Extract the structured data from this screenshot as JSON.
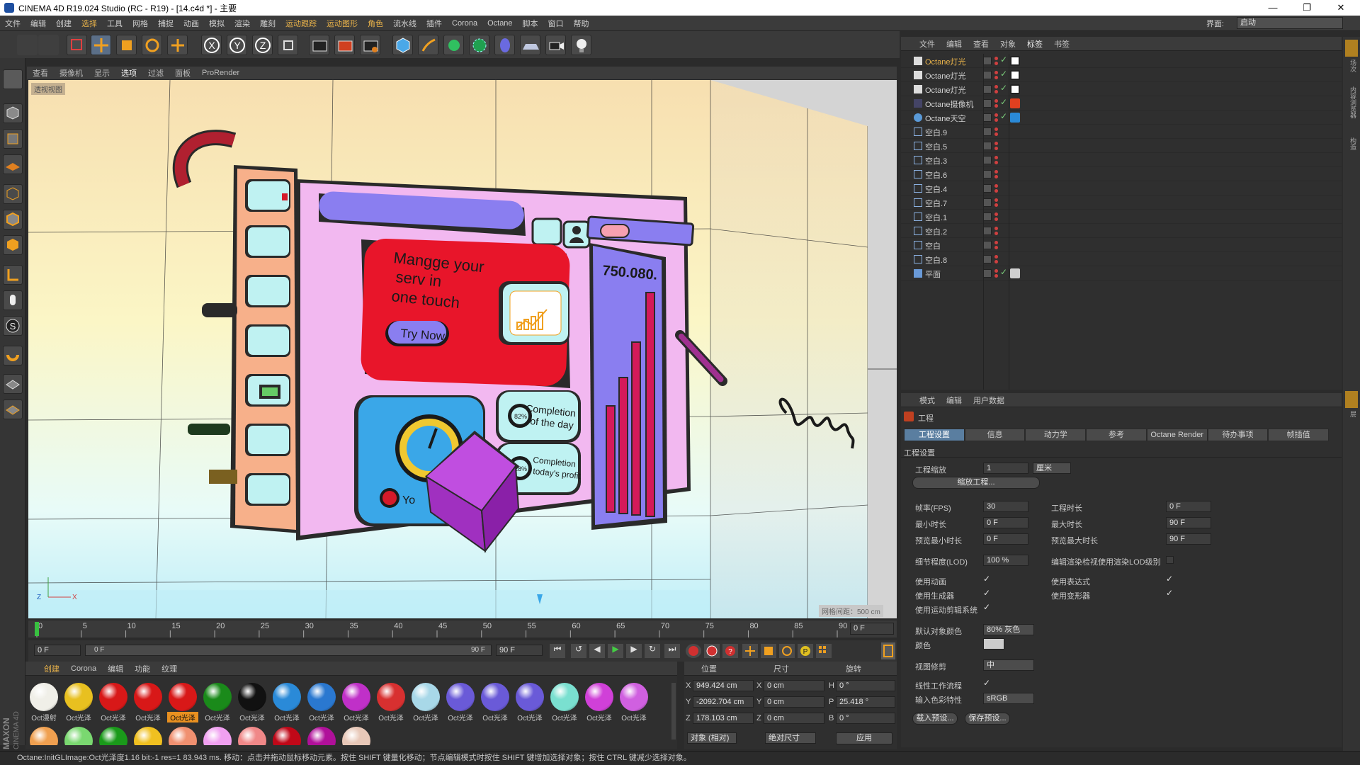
{
  "window": {
    "title": "CINEMA 4D R19.024 Studio (RC - R19) - [14.c4d *] - 主要",
    "minimize": "—",
    "maximize": "❐",
    "close": "✕"
  },
  "menubar": {
    "items": [
      "文件",
      "编辑",
      "创建",
      "选择",
      "工具",
      "网格",
      "捕捉",
      "动画",
      "模拟",
      "渲染",
      "雕刻",
      "运动跟踪",
      "运动图形",
      "角色",
      "流水线",
      "插件",
      "Corona",
      "Octane",
      "脚本",
      "窗口",
      "帮助"
    ],
    "highlighted": [
      "选择",
      "运动跟踪",
      "运动图形",
      "角色"
    ],
    "layout_label": "界面:",
    "layout_value": "启动"
  },
  "viewport": {
    "menu": [
      "查看",
      "摄像机",
      "显示",
      "选项",
      "过滤",
      "面板",
      "ProRender"
    ],
    "highlighted": "选项",
    "camera_badge": "透视视图",
    "grid_readout": "网格间距：500 cm",
    "scene": {
      "card_title": "Mangge your serv in one touch",
      "card_title_lines": [
        "Mangge your",
        "serv  in",
        "one  touch"
      ],
      "button": "Try Now",
      "big_number": "750.080.",
      "pill1_lines": [
        "Completion",
        "of the day"
      ],
      "pill1_badge": "82%",
      "pill2_lines": [
        "Completion",
        "today's profit"
      ],
      "pill2_badge": "28%",
      "gauge_label": "Yo",
      "colors": {
        "card_red": "#e8152a",
        "card_pink": "#f2b8f0",
        "gauge_blue": "#3aa7e8",
        "bar_purple": "#8a7ef0",
        "bar_magenta": "#d41a5a",
        "side_orange": "#f7b08a",
        "side_button": "#bff2f2",
        "cube": "#c04ee0"
      }
    }
  },
  "object_manager": {
    "menu": [
      "文件",
      "编辑",
      "查看",
      "对象",
      "标签",
      "书签"
    ],
    "highlighted": "标签",
    "objects": [
      {
        "name": "Octane灯光",
        "highlighted": true,
        "tag": "light"
      },
      {
        "name": "Octane灯光",
        "highlighted": false,
        "tag": "light"
      },
      {
        "name": "Octane灯光",
        "highlighted": false,
        "tag": "light"
      },
      {
        "name": "Octane摄像机",
        "highlighted": false,
        "tag": "camera"
      },
      {
        "name": "Octane天空",
        "highlighted": false,
        "tag": "sky"
      },
      {
        "name": "空白.9",
        "highlighted": false,
        "tag": ""
      },
      {
        "name": "空白.5",
        "highlighted": false,
        "tag": ""
      },
      {
        "name": "空白.3",
        "highlighted": false,
        "tag": ""
      },
      {
        "name": "空白.6",
        "highlighted": false,
        "tag": ""
      },
      {
        "name": "空白.4",
        "highlighted": false,
        "tag": ""
      },
      {
        "name": "空白.7",
        "highlighted": false,
        "tag": ""
      },
      {
        "name": "空白.1",
        "highlighted": false,
        "tag": ""
      },
      {
        "name": "空白.2",
        "highlighted": false,
        "tag": ""
      },
      {
        "name": "空白",
        "highlighted": false,
        "tag": ""
      },
      {
        "name": "空白.8",
        "highlighted": false,
        "tag": ""
      },
      {
        "name": "平面",
        "highlighted": false,
        "tag": "material"
      }
    ]
  },
  "attribute_manager": {
    "menu": [
      "模式",
      "编辑",
      "用户数据"
    ],
    "header": "工程",
    "tabs": [
      "工程设置",
      "信息",
      "动力学",
      "参考",
      "Octane Render",
      "待办事项",
      "帧插值"
    ],
    "active_tab": "工程设置",
    "section": "工程设置",
    "project_scale_label": "工程缩放",
    "project_scale_value": "1",
    "project_scale_unit": "厘米",
    "scale_project_button": "缩放工程...",
    "fps_label": "帧率(FPS)",
    "fps_value": "30",
    "project_time_label": "工程时长",
    "project_time_value": "0 F",
    "min_time_label": "最小时长",
    "min_time_value": "0 F",
    "max_time_label": "最大时长",
    "max_time_value": "90 F",
    "preview_min_label": "预览最小时长",
    "preview_min_value": "0 F",
    "preview_max_label": "预览最大时长",
    "preview_max_value": "90 F",
    "lod_label": "细节程度(LOD)",
    "lod_value": "100 %",
    "render_lod_label": "编辑渲染检视使用渲染LOD级别",
    "use_anim_label": "使用动画",
    "use_expr_label": "使用表达式",
    "use_gen_label": "使用生成器",
    "use_deform_label": "使用变形器",
    "use_motion_label": "使用运动剪辑系统",
    "default_color_label": "默认对象颜色",
    "default_color_value": "80% 灰色",
    "color_label": "颜色",
    "view_clip_label": "视图修剪",
    "view_clip_value": "中",
    "linear_label": "线性工作流程",
    "input_color_label": "输入色彩特性",
    "input_color_value": "sRGB",
    "load_preset": "载入预设...",
    "save_preset": "保存预设..."
  },
  "timeline": {
    "ticks": [
      "0",
      "5",
      "10",
      "15",
      "20",
      "25",
      "30",
      "35",
      "40",
      "45",
      "50",
      "55",
      "60",
      "65",
      "70",
      "75",
      "80",
      "85",
      "90"
    ],
    "current_frame": "0 F",
    "start": "0 F",
    "range_start": "0 F",
    "range_end": "90 F",
    "end": "90 F"
  },
  "material_manager": {
    "menu": [
      "创建",
      "Corona",
      "编辑",
      "功能",
      "纹理"
    ],
    "highlighted": "创建",
    "materials": [
      {
        "label": "Oct漫射",
        "color": "#f0efe8",
        "selected": false
      },
      {
        "label": "Oct光泽",
        "color": "#e8c020",
        "selected": false
      },
      {
        "label": "Oct光泽",
        "color": "#d81818",
        "selected": false
      },
      {
        "label": "Oct光泽",
        "color": "#d81818",
        "selected": false
      },
      {
        "label": "Oct光泽",
        "color": "#d81818",
        "selected": true
      },
      {
        "label": "Oct光泽",
        "color": "#1a8a1a",
        "selected": false
      },
      {
        "label": "Oct光泽",
        "color": "#111111",
        "selected": false
      },
      {
        "label": "Oct光泽",
        "color": "#2a8ad8",
        "selected": false
      },
      {
        "label": "Oct光泽",
        "color": "#2a78d0",
        "selected": false
      },
      {
        "label": "Oct光泽",
        "color": "#c030c8",
        "selected": false
      },
      {
        "label": "Oct光泽",
        "color": "#d83030",
        "selected": false
      },
      {
        "label": "Oct光泽",
        "color": "#a8d8e8",
        "selected": false
      },
      {
        "label": "Oct光泽",
        "color": "#6a5ad8",
        "selected": false
      },
      {
        "label": "Oct光泽",
        "color": "#6a5ad8",
        "selected": false
      },
      {
        "label": "Oct光泽",
        "color": "#6a5ad8",
        "selected": false
      },
      {
        "label": "Oct光泽",
        "color": "#7ae0d0",
        "selected": false
      },
      {
        "label": "Oct光泽",
        "color": "#d040d8",
        "selected": false
      },
      {
        "label": "Oct光泽",
        "color": "#d060e0",
        "selected": false
      }
    ],
    "row2_colors": [
      "#f0a050",
      "#7ad870",
      "#1a9a1a",
      "#f0c020",
      "#f09070",
      "#f0a0f0",
      "#f08888",
      "#c00818",
      "#b0109a",
      "#e8c8b8"
    ]
  },
  "coordinates": {
    "headers": [
      "位置",
      "尺寸",
      "旋转"
    ],
    "rows": [
      {
        "axis": "X",
        "pos": "949.424 cm",
        "size_axis": "X",
        "size": "0 cm",
        "rot_axis": "H",
        "rot": "0 °"
      },
      {
        "axis": "Y",
        "pos": "-2092.704 cm",
        "size_axis": "Y",
        "size": "0 cm",
        "rot_axis": "P",
        "rot": "25.418 °"
      },
      {
        "axis": "Z",
        "pos": "178.103 cm",
        "size_axis": "Z",
        "size": "0 cm",
        "rot_axis": "B",
        "rot": "0 °"
      }
    ],
    "mode": "对象 (相对)",
    "size_mode": "绝对尺寸",
    "apply": "应用"
  },
  "statusbar": {
    "text": "Octane:InitGLImage:Oct光泽度1.16  bit:-1 res=1  83.943 ms.    移动：点击并拖动鼠标移动元素。按住 SHIFT 键量化移动；节点编辑模式时按住 SHIFT 键增加选择对象；按住 CTRL 键减少选择对象。"
  },
  "branding": {
    "maxon": "MAXON",
    "cinema": "CINEMA 4D"
  },
  "right_strip": [
    "对象",
    "场次",
    "内容浏览器",
    "构造"
  ],
  "right_strip_lower": [
    "属性",
    "层"
  ]
}
